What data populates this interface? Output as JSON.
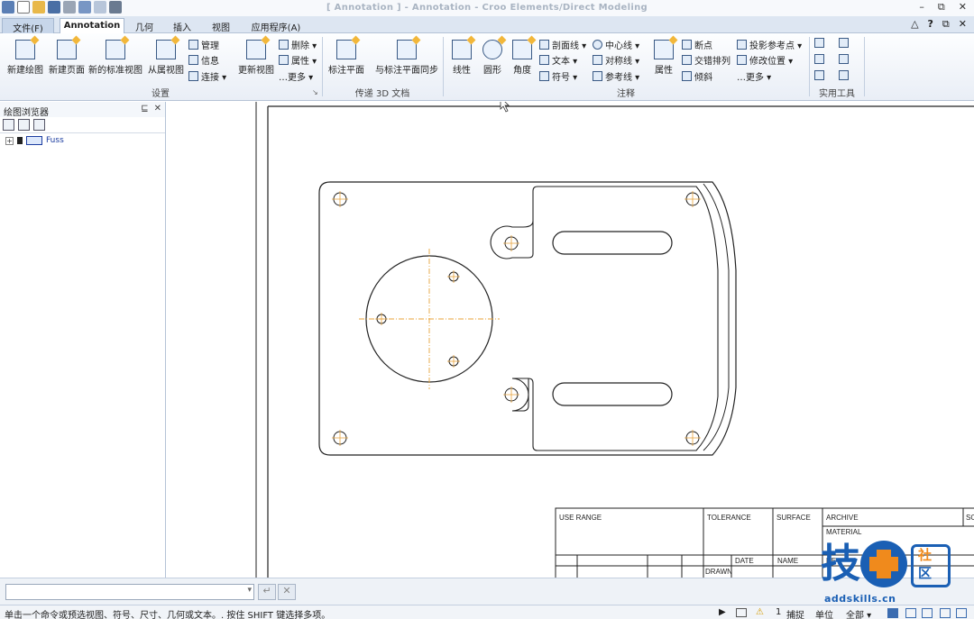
{
  "window": {
    "title": "[ Annotation ] - Annotation - Croo Elements/Direct Modeling",
    "controls": [
      "–",
      "⧉",
      "✕"
    ],
    "help_icons": [
      "△",
      "?",
      "⧉",
      "✕"
    ]
  },
  "tabs": [
    "文件(F)",
    "Annotation",
    "几何",
    "插入",
    "视图",
    "应用程序(A)"
  ],
  "ribbon": {
    "setup": {
      "buttons": [
        "新建绘图",
        "新建页面",
        "新的标准视图",
        "从属视图"
      ],
      "small": [
        "管理",
        "信息",
        "连接 ▾"
      ],
      "update_view": "更新视图",
      "small2": [
        "删除 ▾",
        "属性 ▾",
        "…更多 ▾"
      ],
      "label": "设置"
    },
    "pmi": {
      "buttons": [
        "标注平面",
        "与标注平面同步"
      ],
      "label": "传递 3D 文档"
    },
    "annotation": {
      "buttons": [
        "线性",
        "圆形",
        "角度"
      ],
      "col1": [
        "剖面线 ▾",
        "文本 ▾",
        "符号 ▾"
      ],
      "col2": [
        "中心线 ▾",
        "对称线 ▾",
        "参考线 ▾"
      ],
      "props": "属性",
      "col3": [
        "断点",
        "交错排列",
        "倾斜"
      ],
      "col4": [
        "投影参考点 ▾",
        "修改位置 ▾",
        "…更多 ▾"
      ],
      "label": "注释"
    },
    "utility": {
      "label": "实用工具"
    }
  },
  "browser": {
    "title": "绘图浏览器",
    "pin": "⊑",
    "close": "✕",
    "tree_item": "Fuss"
  },
  "title_block": {
    "use_range": "USE RANGE",
    "tolerance": "TOLERANCE",
    "surface": "SURFACE",
    "archive": "ARCHIVE",
    "sc": "SC",
    "material": "MATERIAL",
    "date": "DATE",
    "name": "NAME",
    "de": "DE",
    "drawn": "DRAWN"
  },
  "status": {
    "message": "单击一个命令或预选视图、符号、尺寸、几何或文本。. 按住 SHIFT 键选择多项。",
    "count": "1",
    "snap": "捕捉",
    "unit": "单位",
    "all": "全部 ▾"
  },
  "watermark": {
    "char": "技",
    "she": "社",
    "qu": "区",
    "url": "addskills.cn"
  },
  "colors": {
    "accent": "#1a5fb4",
    "orange": "#f08a1c",
    "centerline": "#e8a33a"
  }
}
